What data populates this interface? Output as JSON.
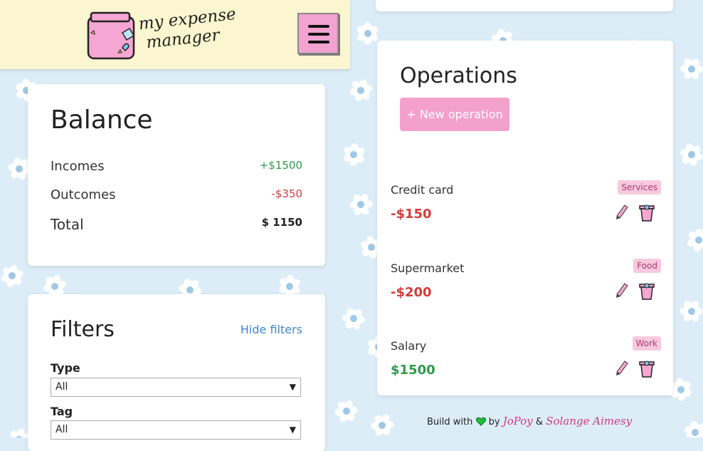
{
  "header": {
    "logo_line1": "my expense",
    "logo_line2": "manager",
    "menu_icon": "hamburger-menu-icon"
  },
  "balance": {
    "title": "Balance",
    "incomes_label": "Incomes",
    "incomes_value": "+$1500",
    "outcomes_label": "Outcomes",
    "outcomes_value": "-$350",
    "total_label": "Total",
    "total_value": "$ 1150"
  },
  "filters": {
    "title": "Filters",
    "hide_link": "Hide filters",
    "type_label": "Type",
    "type_value": "All",
    "tag_label": "Tag",
    "tag_value": "All"
  },
  "operations": {
    "title": "Operations",
    "new_button": "+ New operation",
    "items": [
      {
        "description": "Credit card",
        "amount": "-$150",
        "tag": "Services"
      },
      {
        "description": "Supermarket",
        "amount": "-$200",
        "tag": "Food"
      },
      {
        "description": "Salary",
        "amount": "$1500",
        "tag": "Work"
      }
    ]
  },
  "footer": {
    "prefix": "Build with",
    "by": "by",
    "author1": "JoPoy",
    "and": "&",
    "author2": "Solange Aimesy"
  },
  "colors": {
    "income": "#2e9a4a",
    "outcome": "#d33b3b",
    "accent": "#f4a0cd",
    "link": "#3d86d6",
    "header_bg": "#fbf6cf",
    "page_bg": "#dcedf8"
  }
}
